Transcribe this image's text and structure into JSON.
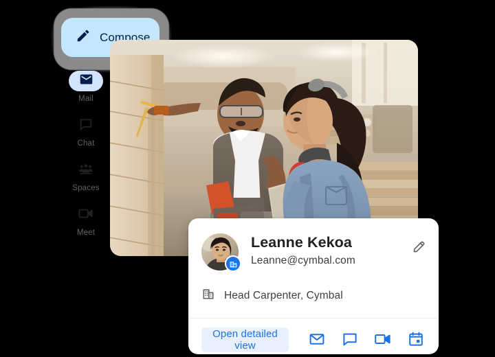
{
  "app": {
    "background_color": "#000000"
  },
  "compose": {
    "label": "Compose",
    "icon": "pencil-icon",
    "background_color": "#c2e7ff",
    "text_color": "#041e49"
  },
  "sidebar": {
    "items": [
      {
        "label": "Mail",
        "icon": "envelope-icon",
        "active": true
      },
      {
        "label": "Chat",
        "icon": "chat-bubble-icon",
        "active": false
      },
      {
        "label": "Spaces",
        "icon": "people-group-icon",
        "active": false
      },
      {
        "label": "Meet",
        "icon": "video-camera-icon",
        "active": false
      }
    ],
    "active_pill_color": "#d3e3fd",
    "label_color": "#5f6368"
  },
  "photo": {
    "alt": "Two carpenters in a woodshop, a man marking a wood panel with a pencil and a woman holding a laptop",
    "corner_radius_px": 16
  },
  "contact_card": {
    "name": "Leanne Kekoa",
    "email": "Leanne@cymbal.com",
    "avatar_badge_icon": "building-badge-icon",
    "edit_icon": "pencil-edit-icon",
    "role_icon": "building-icon",
    "role": "Head Carpenter, Cymbal",
    "primary_action": {
      "label": "Open detailed view",
      "background_color": "#e8f0fe",
      "text_color": "#1a73e8"
    },
    "action_icons": [
      {
        "name": "email-icon"
      },
      {
        "name": "chat-icon"
      },
      {
        "name": "video-call-icon"
      },
      {
        "name": "calendar-icon"
      }
    ],
    "accent_color": "#1a73e8"
  }
}
